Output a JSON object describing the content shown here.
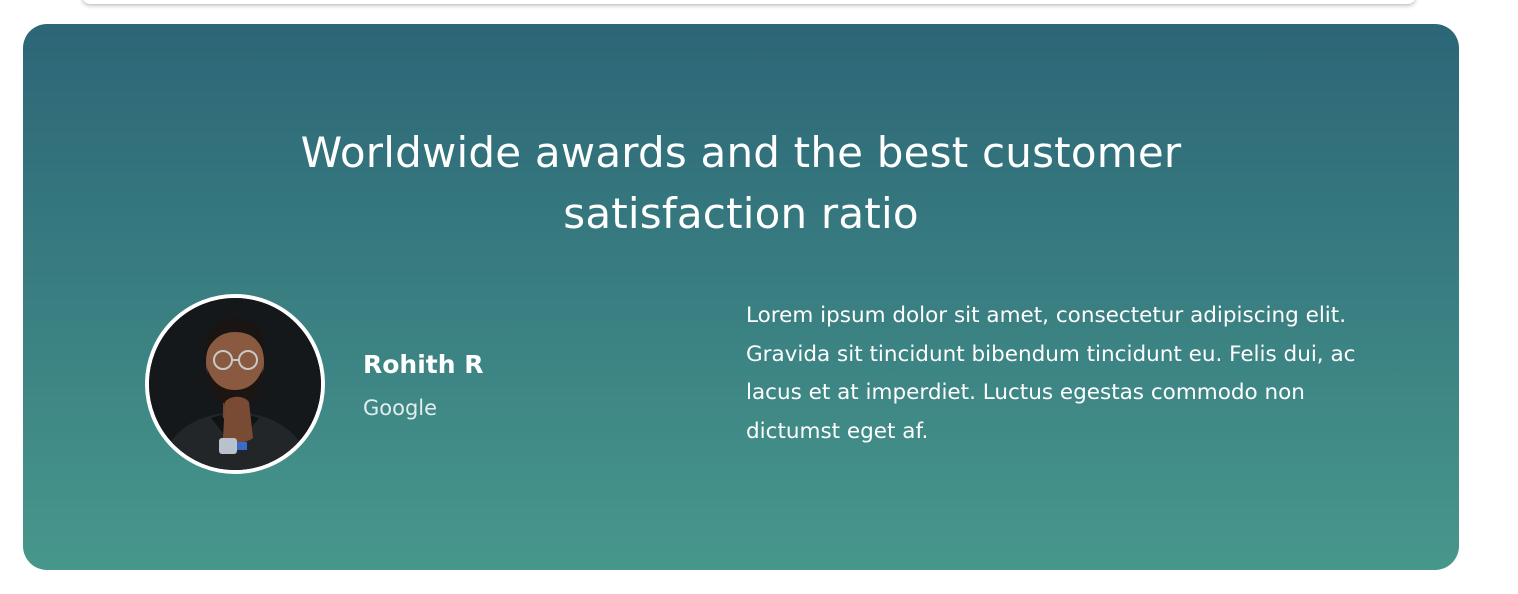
{
  "testimonial": {
    "headline": "Worldwide awards and the best customer satisfaction ratio",
    "person": {
      "name": "Rohith R",
      "company": "Google",
      "avatar_alt": "Rohith R portrait"
    },
    "quote": "Lorem ipsum dolor sit amet, consectetur adipiscing elit. Gravida sit tincidunt bibendum tincidunt eu. Felis dui, ac lacus et at imperdiet. Luctus egestas commodo non dictumst eget af."
  },
  "colors": {
    "gradient_top": "#2c6677",
    "gradient_bottom": "#47978c",
    "text": "#ffffff"
  }
}
